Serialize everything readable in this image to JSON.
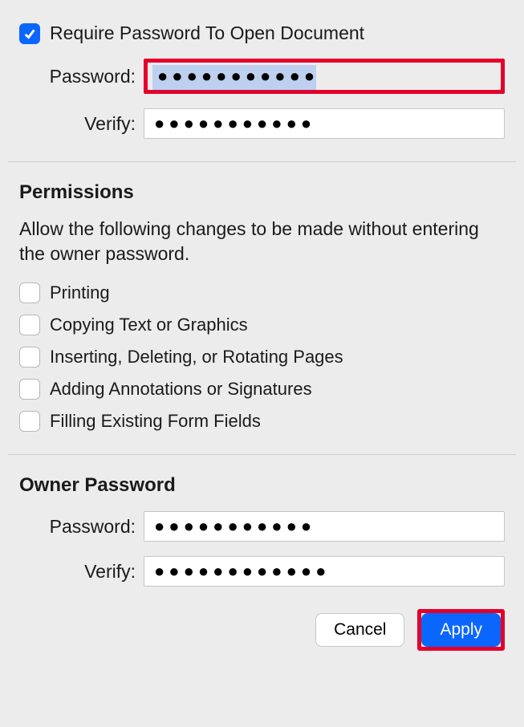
{
  "requirePassword": {
    "label": "Require Password To Open Document",
    "checked": true
  },
  "openPassword": {
    "passwordLabel": "Password:",
    "passwordValue": "●●●●●●●●●●●",
    "verifyLabel": "Verify:",
    "verifyValue": "●●●●●●●●●●●"
  },
  "permissions": {
    "title": "Permissions",
    "description": "Allow the following changes to be made without entering the owner password.",
    "items": [
      {
        "label": "Printing",
        "checked": false
      },
      {
        "label": "Copying Text or Graphics",
        "checked": false
      },
      {
        "label": "Inserting, Deleting, or Rotating Pages",
        "checked": false
      },
      {
        "label": "Adding Annotations or Signatures",
        "checked": false
      },
      {
        "label": "Filling Existing Form Fields",
        "checked": false
      }
    ]
  },
  "ownerPassword": {
    "title": "Owner Password",
    "passwordLabel": "Password:",
    "passwordValue": "●●●●●●●●●●●",
    "verifyLabel": "Verify:",
    "verifyValue": "●●●●●●●●●●●●"
  },
  "buttons": {
    "cancel": "Cancel",
    "apply": "Apply"
  }
}
